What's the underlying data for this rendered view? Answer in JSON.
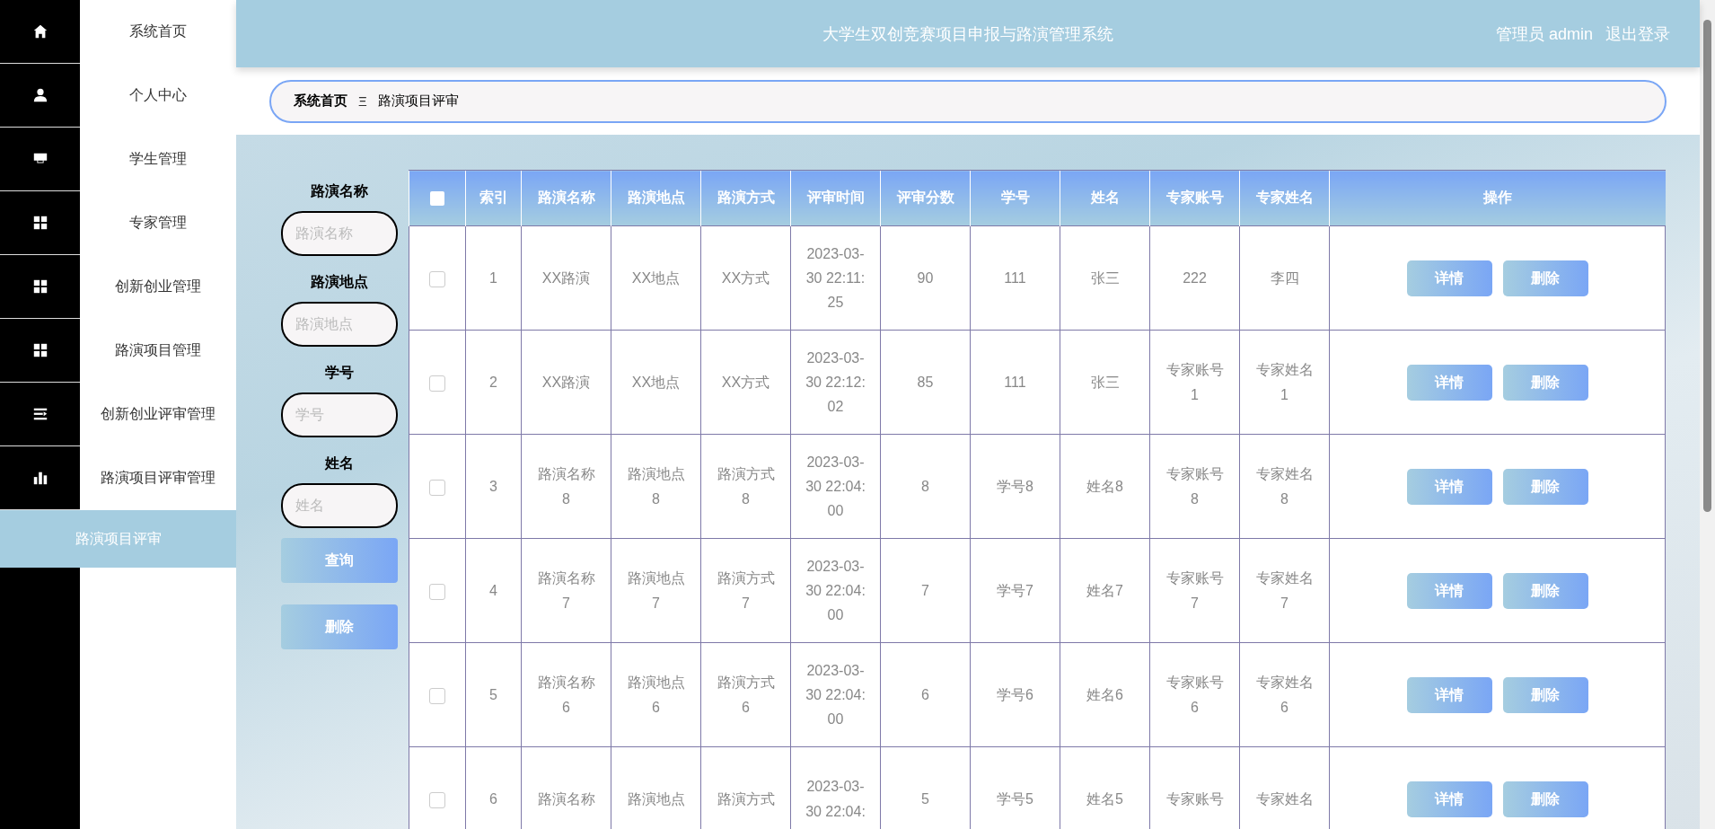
{
  "sidebar": {
    "items": [
      {
        "label": "系统首页",
        "kind": "home",
        "selected": false
      },
      {
        "label": "个人中心",
        "kind": "user",
        "selected": false
      },
      {
        "label": "学生管理",
        "kind": "store",
        "selected": false
      },
      {
        "label": "专家管理",
        "kind": "grid",
        "selected": false
      },
      {
        "label": "创新创业管理",
        "kind": "grid",
        "selected": false
      },
      {
        "label": "路演项目管理",
        "kind": "grid",
        "selected": false
      },
      {
        "label": "创新创业评审管理",
        "kind": "list",
        "selected": false
      },
      {
        "label": "路演项目评审管理",
        "kind": "chart",
        "selected": false
      },
      {
        "label": "路演项目评审",
        "kind": "sub",
        "selected": true
      }
    ]
  },
  "header": {
    "title": "大学生双创竞赛项目申报与路演管理系统",
    "user": "管理员 admin",
    "logout": "退出登录"
  },
  "breadcrumb": {
    "home": "系统首页",
    "separator": "Ξ",
    "current": "路演项目评审"
  },
  "search": {
    "fields": [
      {
        "label": "路演名称",
        "placeholder": "路演名称"
      },
      {
        "label": "路演地点",
        "placeholder": "路演地点"
      },
      {
        "label": "学号",
        "placeholder": "学号"
      },
      {
        "label": "姓名",
        "placeholder": "姓名"
      }
    ],
    "query_button": "查询",
    "delete_button": "删除"
  },
  "table": {
    "select_all_checked": false,
    "columns": [
      "索引",
      "路演名称",
      "路演地点",
      "路演方式",
      "评审时间",
      "评审分数",
      "学号",
      "姓名",
      "专家账号",
      "专家姓名",
      "操作"
    ],
    "rows": [
      {
        "checked": false,
        "cells": [
          "1",
          "XX路演",
          "XX地点",
          "XX方式",
          "2023-03-30 22:11:25",
          "90",
          "111",
          "张三",
          "222",
          "李四"
        ],
        "actions": [
          "详情",
          "删除"
        ]
      },
      {
        "checked": false,
        "cells": [
          "2",
          "XX路演",
          "XX地点",
          "XX方式",
          "2023-03-30 22:12:02",
          "85",
          "111",
          "张三",
          "专家账号1",
          "专家姓名1"
        ],
        "actions": [
          "详情",
          "删除"
        ]
      },
      {
        "checked": false,
        "cells": [
          "3",
          "路演名称8",
          "路演地点8",
          "路演方式8",
          "2023-03-30 22:04:00",
          "8",
          "学号8",
          "姓名8",
          "专家账号8",
          "专家姓名8"
        ],
        "actions": [
          "详情",
          "删除"
        ]
      },
      {
        "checked": false,
        "cells": [
          "4",
          "路演名称7",
          "路演地点7",
          "路演方式7",
          "2023-03-30 22:04:00",
          "7",
          "学号7",
          "姓名7",
          "专家账号7",
          "专家姓名7"
        ],
        "actions": [
          "详情",
          "删除"
        ]
      },
      {
        "checked": false,
        "cells": [
          "5",
          "路演名称6",
          "路演地点6",
          "路演方式6",
          "2023-03-30 22:04:00",
          "6",
          "学号6",
          "姓名6",
          "专家账号6",
          "专家姓名6"
        ],
        "actions": [
          "详情",
          "删除"
        ]
      },
      {
        "checked": false,
        "cells": [
          "6",
          "路演名称",
          "路演地点",
          "路演方式",
          "2023-03-30 22:04:",
          "5",
          "学号5",
          "姓名5",
          "专家账号",
          "专家姓名"
        ],
        "actions": [
          "详情",
          "删除"
        ]
      }
    ]
  }
}
